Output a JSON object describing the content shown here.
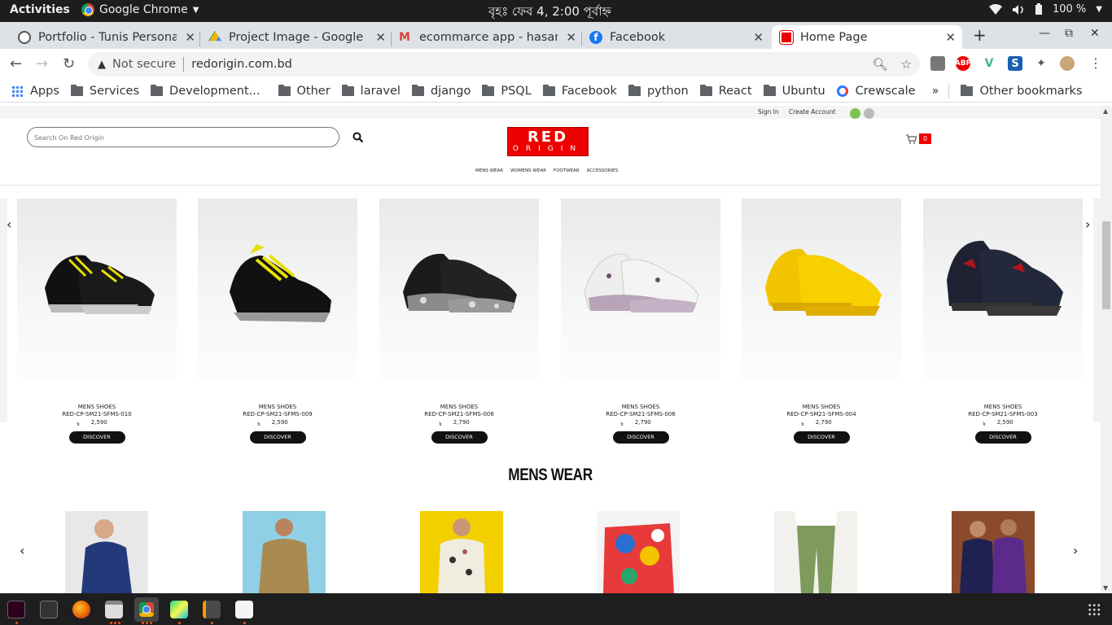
{
  "system": {
    "activities": "Activities",
    "app_name": "Google Chrome",
    "clock": "বৃহঃ ফেব  4,  2:00 পূর্বাহ্ন",
    "battery": "100 %"
  },
  "tabs": [
    {
      "title": "Portfolio - Tunis Personal",
      "favicon": "globe-icon",
      "active": false
    },
    {
      "title": "Project Image - Google Drive",
      "favicon": "drive-icon",
      "active": false
    },
    {
      "title": "ecommarce app - hasanm",
      "favicon": "gmail-icon",
      "active": false
    },
    {
      "title": "Facebook",
      "favicon": "facebook-icon",
      "active": false
    },
    {
      "title": "Home Page",
      "favicon": "redorigin-icon",
      "active": true
    }
  ],
  "toolbar": {
    "security": "Not secure",
    "url": "redorigin.com.bd"
  },
  "bookmarks": {
    "apps": "Apps",
    "items": [
      "Services",
      "Development...",
      "Other",
      "laravel",
      "django",
      "PSQL",
      "Facebook",
      "python",
      "React",
      "Ubuntu",
      "Crewscale"
    ],
    "overflow": "»",
    "other": "Other bookmarks"
  },
  "site": {
    "sign_in": "Sign In",
    "create_account": "Create Account",
    "search_placeholder": "Search On Red Origin",
    "logo_top": "RED",
    "logo_bottom": "ORIGIN",
    "cart_count": "0",
    "nav": [
      "MENS WEAR",
      "WOMENS WEAR",
      "FOOTWEAR",
      "ACCESSORIES"
    ],
    "brand_color": "#e00000",
    "currency": "৳",
    "products": [
      {
        "category": "MENS SHOES",
        "code": "RED-CP-SM21-SFMS-010",
        "price": "2,590",
        "button": "DISCOVER",
        "color": "black-yellow"
      },
      {
        "category": "MENS SHOES",
        "code": "RED-CP-SM21-SFMS-009",
        "price": "2,590",
        "button": "DISCOVER",
        "color": "black-neon"
      },
      {
        "category": "MENS SHOES",
        "code": "RED-CP-SM21-SFMS-008",
        "price": "2,790",
        "button": "DISCOVER",
        "color": "black-floral"
      },
      {
        "category": "MENS SHOES",
        "code": "RED-CP-SM21-SFMS-006",
        "price": "2,790",
        "button": "DISCOVER",
        "color": "white-floral"
      },
      {
        "category": "MENS SHOES",
        "code": "RED-CP-SM21-SFMS-004",
        "price": "2,790",
        "button": "DISCOVER",
        "color": "yellow"
      },
      {
        "category": "MENS SHOES",
        "code": "RED-CP-SM21-SFMS-003",
        "price": "2,590",
        "button": "DISCOVER",
        "color": "navy-red"
      }
    ],
    "section_title": "MENS WEAR"
  }
}
